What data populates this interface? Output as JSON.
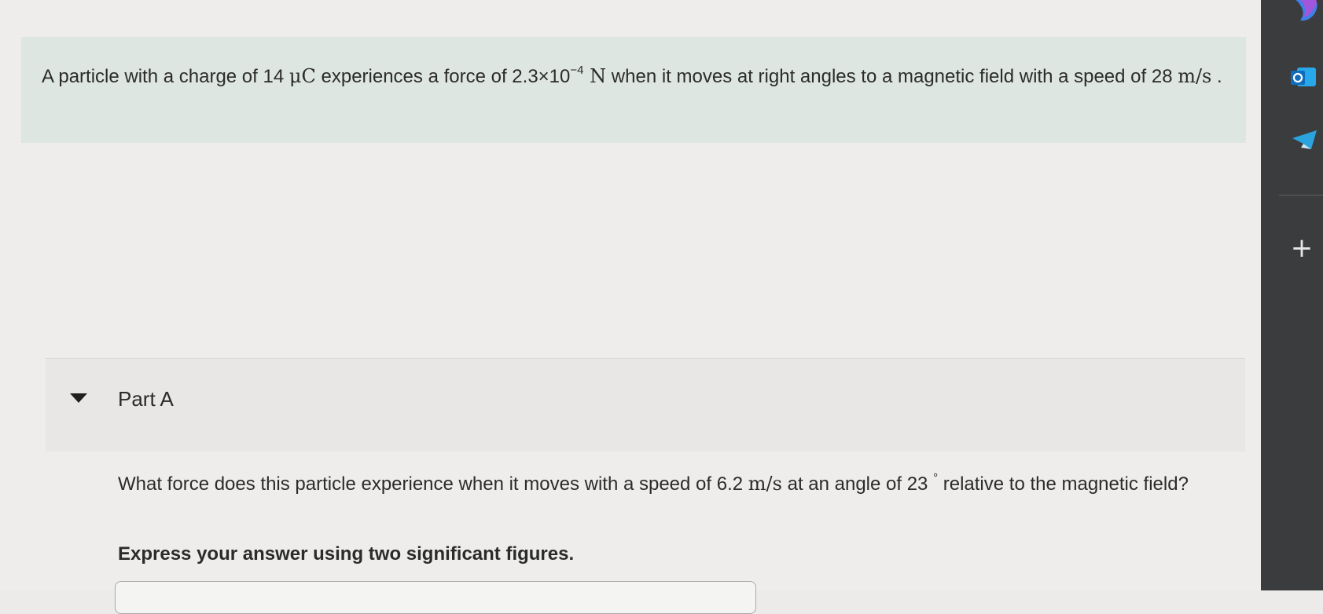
{
  "problem": {
    "text_1": "A particle with a charge of 14 ",
    "charge_unit": "μC",
    "text_2": " experiences a force of 2.3×10",
    "force_exponent": "−4",
    "force_unit": " N",
    "text_3": " when it moves at right angles to a magnetic field with a speed of 28 ",
    "speed_unit": "m/s",
    "text_4": " ."
  },
  "part": {
    "title": "Part A",
    "question_1": "What force does this particle experience when it moves with a speed of 6.2 ",
    "question_unit": "m/s",
    "question_2": " at an angle of 23 ",
    "degree": "°",
    "question_3": " relative to the magnetic field?",
    "instruction": "Express your answer using two significant figures."
  },
  "taskbar": {
    "add_label": "+",
    "icons": [
      "copilot-icon",
      "outlook-icon",
      "telegram-icon"
    ],
    "colors": {
      "outlook": "#1473c8",
      "telegram": "#2aa3df"
    }
  }
}
